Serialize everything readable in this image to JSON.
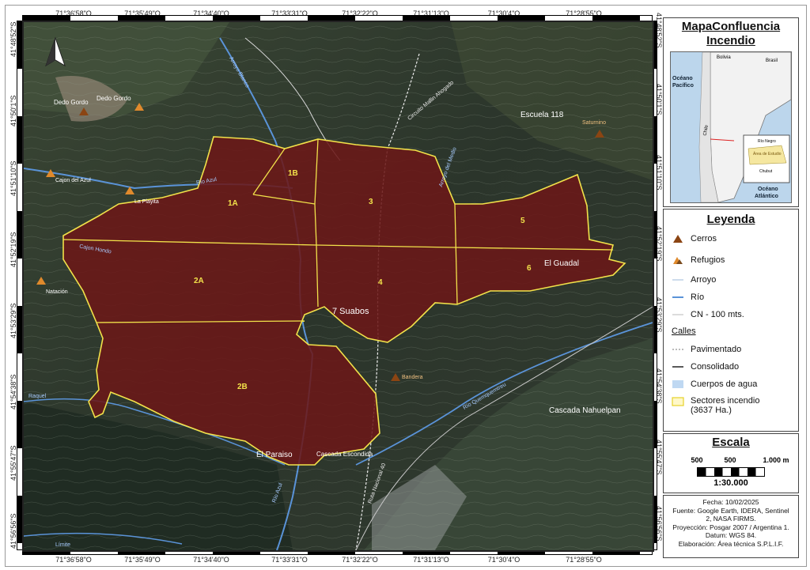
{
  "title": {
    "line1": "MapaConfluencia",
    "line2": "Incendio"
  },
  "coordinates": {
    "longitudes": [
      "71°36'58\"O",
      "71°35'49\"O",
      "71°34'40\"O",
      "71°33'31\"O",
      "71°32'22\"O",
      "71°31'13\"O",
      "71°30'4\"O",
      "71°28'55\"O"
    ],
    "latitudes": [
      "41°48'52\"S",
      "41°50'1\"S",
      "41°51'10\"S",
      "41°52'19\"S",
      "41°53'29\"S",
      "41°54'38\"S",
      "41°55'47\"S",
      "41°56'56\"S"
    ]
  },
  "map": {
    "sectors": [
      "1A",
      "1B",
      "2A",
      "2B",
      "3",
      "4",
      "5",
      "6",
      "7 Suabos"
    ],
    "places": {
      "dedo_gordo_1": "Dedo Gordo",
      "dedo_gordo_2": "Dedo Gordo",
      "escuela": "Escuela 118",
      "saturnino": "Saturnino",
      "cajon_azul": "Cajon del Azul",
      "la_playita": "La Playita",
      "natacion": "Natación",
      "el_guadal": "El Guadal",
      "bandera": "Bandera",
      "cascada_nahuelpan": "Cascada Nahuelpan",
      "el_paraiso": "El Paraiso",
      "cascada_escondida": "Cascada Escondida"
    },
    "waterways": {
      "rio_azul": "Río Azul",
      "arroyo_blanco": "Arroyo Blanco",
      "cajon_hondo": "Cajon Hondo",
      "raquel": "Raquel",
      "rio_quemquemtreu": "Río Quemquemtreu",
      "limite": "Límite",
      "arroyo_del_medio": "Arroyo del Medio",
      "rio_azul_south": "Río Azul"
    },
    "roads": {
      "circuito": "Circuito Mallin Ahogado",
      "ruta": "Ruta Nacional 40"
    }
  },
  "inset": {
    "bolivia": "Bolivia",
    "brasil": "Brasil",
    "oceano_pacifico_1": "Océano",
    "oceano_pacifico_2": "Pacífico",
    "oceano_atlantico_1": "Océano",
    "oceano_atlantico_2": "Atlántico",
    "chile": "Chile",
    "area_estudio": "Área de Estudio",
    "rio_negro": "Río Negro",
    "chubut": "Chubut"
  },
  "legend": {
    "title": "Leyenda",
    "items": {
      "cerros": "Cerros",
      "refugios": "Refugios",
      "arroyo": "Arroyo",
      "rio": "Río",
      "cn": "CN - 100 mts.",
      "calles": "Calles",
      "pavimentado": "Pavimentado",
      "consolidado": "Consolidado",
      "cuerpos": "Cuerpos de agua",
      "sectores_1": "Sectores incendio",
      "sectores_2": "(3637 Ha.)"
    }
  },
  "scale": {
    "title": "Escala",
    "labels": [
      "500",
      "500",
      "1.000 m"
    ],
    "ratio": "1:30.000"
  },
  "info": {
    "fecha": "Fecha: 10/02/2025",
    "fuente_1": "Fuente: Google Earth, IDERA, Sentinel",
    "fuente_2": "2, NASA FIRMS.",
    "proyeccion": "Proyección: Posgar 2007 / Argentina 1.",
    "datum": "Datum: WGS 84.",
    "elaboracion": "Elaboración: Área técnica S.P.L.I.F."
  },
  "colors": {
    "fire_fill": "#6b1818",
    "sector_line": "#f2e24a",
    "river": "#5a93d8",
    "satellite_dark": "#2d3a2a"
  }
}
